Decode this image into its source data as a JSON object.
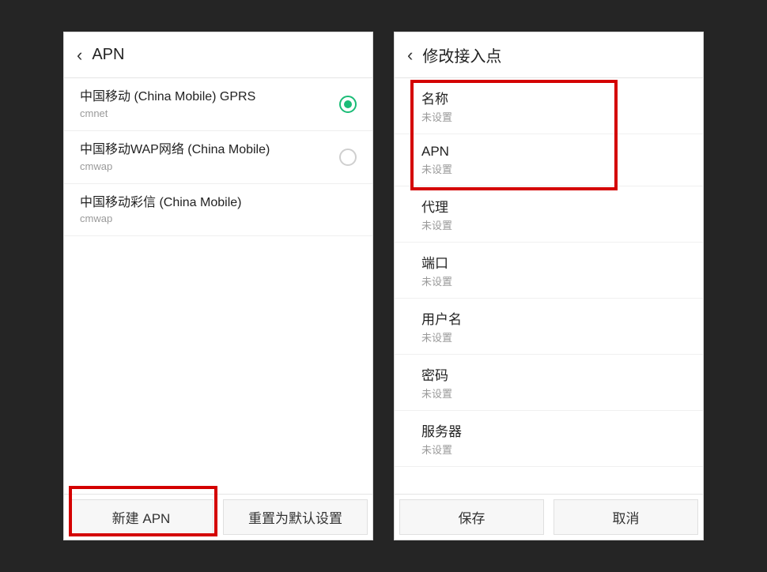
{
  "left": {
    "title": "APN",
    "apns": [
      {
        "name": "中国移动 (China Mobile) GPRS",
        "id": "cmnet",
        "selected": true,
        "has_radio": true
      },
      {
        "name": "中国移动WAP网络 (China Mobile)",
        "id": "cmwap",
        "selected": false,
        "has_radio": true
      },
      {
        "name": "中国移动彩信 (China Mobile)",
        "id": "cmwap",
        "selected": false,
        "has_radio": false
      }
    ],
    "new_btn": "新建 APN",
    "reset_btn": "重置为默认设置"
  },
  "right": {
    "title": "修改接入点",
    "fields": [
      {
        "label": "名称",
        "value": "未设置"
      },
      {
        "label": "APN",
        "value": "未设置"
      },
      {
        "label": "代理",
        "value": "未设置"
      },
      {
        "label": "端口",
        "value": "未设置"
      },
      {
        "label": "用户名",
        "value": "未设置"
      },
      {
        "label": "密码",
        "value": "未设置"
      },
      {
        "label": "服务器",
        "value": "未设置"
      }
    ],
    "save_btn": "保存",
    "cancel_btn": "取消"
  }
}
